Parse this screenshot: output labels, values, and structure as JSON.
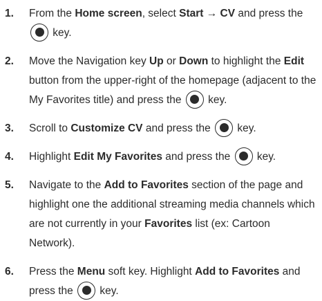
{
  "steps": [
    {
      "number": "1.",
      "segments": [
        {
          "t": "text",
          "v": "From the "
        },
        {
          "t": "bold",
          "v": "Home screen"
        },
        {
          "t": "text",
          "v": ", select "
        },
        {
          "t": "bold",
          "v": "Start → CV"
        },
        {
          "t": "text",
          "v": " and press the "
        },
        {
          "t": "icon",
          "v": "ok-key-icon"
        },
        {
          "t": "text",
          "v": " key."
        }
      ]
    },
    {
      "number": "2.",
      "segments": [
        {
          "t": "text",
          "v": "Move the Navigation key "
        },
        {
          "t": "bold",
          "v": "Up"
        },
        {
          "t": "text",
          "v": " or "
        },
        {
          "t": "bold",
          "v": "Down"
        },
        {
          "t": "text",
          "v": " to highlight the "
        },
        {
          "t": "bold",
          "v": "Edit"
        },
        {
          "t": "text",
          "v": " button from the upper-right of the homepage (adjacent to the My Favorites title) and press the "
        },
        {
          "t": "icon",
          "v": "ok-key-icon"
        },
        {
          "t": "text",
          "v": " key."
        }
      ]
    },
    {
      "number": "3.",
      "segments": [
        {
          "t": "text",
          "v": "Scroll to "
        },
        {
          "t": "bold",
          "v": "Customize CV"
        },
        {
          "t": "text",
          "v": " and press the "
        },
        {
          "t": "icon",
          "v": "ok-key-icon"
        },
        {
          "t": "text",
          "v": " key."
        }
      ]
    },
    {
      "number": "4.",
      "segments": [
        {
          "t": "text",
          "v": "Highlight "
        },
        {
          "t": "bold",
          "v": "Edit My Favorites"
        },
        {
          "t": "text",
          "v": " and press the "
        },
        {
          "t": "icon",
          "v": "ok-key-icon"
        },
        {
          "t": "text",
          "v": " key."
        }
      ]
    },
    {
      "number": "5.",
      "segments": [
        {
          "t": "text",
          "v": "Navigate to the "
        },
        {
          "t": "bold",
          "v": "Add to Favorites"
        },
        {
          "t": "text",
          "v": " section of the page and highlight one the additional streaming media channels which are not currently in your "
        },
        {
          "t": "bold",
          "v": "Favorites"
        },
        {
          "t": "text",
          "v": " list (ex: Cartoon Network)."
        }
      ]
    },
    {
      "number": "6.",
      "segments": [
        {
          "t": "text",
          "v": "Press the "
        },
        {
          "t": "bold",
          "v": "Menu"
        },
        {
          "t": "text",
          "v": " soft key. Highlight "
        },
        {
          "t": "bold",
          "v": "Add to Favorites"
        },
        {
          "t": "text",
          "v": " and press the "
        },
        {
          "t": "icon",
          "v": "ok-key-icon"
        },
        {
          "t": "text",
          "v": " key."
        }
      ]
    }
  ]
}
